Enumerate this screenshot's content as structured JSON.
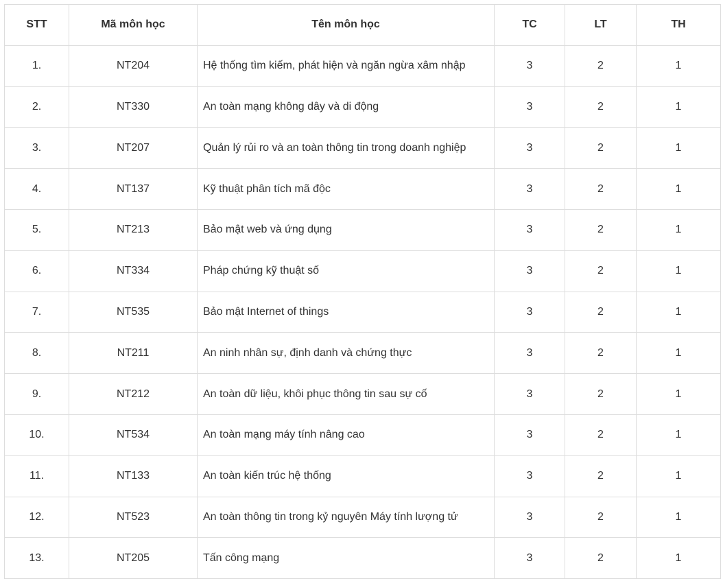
{
  "table": {
    "headers": [
      "STT",
      "Mã môn học",
      "Tên môn học",
      "TC",
      "LT",
      "TH"
    ],
    "rows": [
      {
        "stt": "1.",
        "code": "NT204",
        "name": "Hệ thống tìm kiếm, phát hiện và ngăn ngừa xâm nhập",
        "tc": "3",
        "lt": "2",
        "th": "1"
      },
      {
        "stt": "2.",
        "code": "NT330",
        "name": "An toàn mạng không dây và di động",
        "tc": "3",
        "lt": "2",
        "th": "1"
      },
      {
        "stt": "3.",
        "code": "NT207",
        "name": "Quản lý rủi ro và an toàn thông tin trong doanh nghiệp",
        "tc": "3",
        "lt": "2",
        "th": "1"
      },
      {
        "stt": "4.",
        "code": "NT137",
        "name": "Kỹ thuật phân tích mã độc",
        "tc": "3",
        "lt": "2",
        "th": "1"
      },
      {
        "stt": "5.",
        "code": "NT213",
        "name": "Bảo mật web và ứng dụng",
        "tc": "3",
        "lt": "2",
        "th": "1"
      },
      {
        "stt": "6.",
        "code": "NT334",
        "name": "Pháp chứng kỹ thuật số",
        "tc": "3",
        "lt": "2",
        "th": "1"
      },
      {
        "stt": "7.",
        "code": "NT535",
        "name": "Bảo mật Internet of things",
        "tc": "3",
        "lt": "2",
        "th": "1"
      },
      {
        "stt": "8.",
        "code": "NT211",
        "name": "An ninh nhân sự, định danh và chứng thực",
        "tc": "3",
        "lt": "2",
        "th": "1"
      },
      {
        "stt": "9.",
        "code": "NT212",
        "name": "An toàn dữ liệu, khôi phục thông tin sau sự cố",
        "tc": "3",
        "lt": "2",
        "th": "1"
      },
      {
        "stt": "10.",
        "code": "NT534",
        "name": "An toàn mạng máy tính nâng cao",
        "tc": "3",
        "lt": "2",
        "th": "1"
      },
      {
        "stt": "11.",
        "code": "NT133",
        "name": "An toàn kiến trúc hệ thống",
        "tc": "3",
        "lt": "2",
        "th": "1"
      },
      {
        "stt": "12.",
        "code": "NT523",
        "name": "An toàn thông tin trong kỷ nguyên Máy tính lượng tử",
        "tc": "3",
        "lt": "2",
        "th": "1"
      },
      {
        "stt": "13.",
        "code": "NT205",
        "name": "Tấn công mạng",
        "tc": "3",
        "lt": "2",
        "th": "1"
      }
    ]
  }
}
